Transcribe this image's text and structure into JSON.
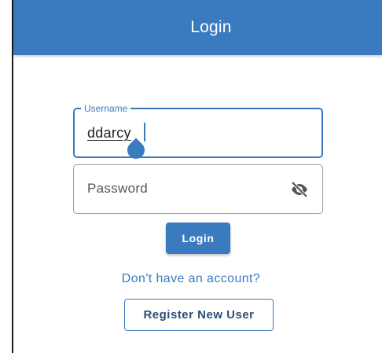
{
  "appbar": {
    "title": "Login",
    "color": "#3a7bbf"
  },
  "username": {
    "label": "Username",
    "value": "ddarcy"
  },
  "password": {
    "placeholder": "Password",
    "toggle_icon": "eye-off-icon"
  },
  "login_button": {
    "label": "Login"
  },
  "register": {
    "prompt": "Don't have an account?",
    "button_label": "Register New User"
  }
}
